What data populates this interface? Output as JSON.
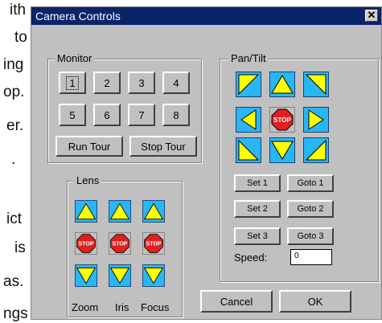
{
  "background_fragments": [
    "ith",
    "to",
    "ing",
    "op.",
    "er.",
    ".",
    "ict",
    "is",
    "as.",
    "ngs"
  ],
  "dialog": {
    "title": "Camera Controls",
    "close_symbol": "✕"
  },
  "monitor": {
    "label": "Monitor",
    "buttons": [
      "1",
      "2",
      "3",
      "4",
      "5",
      "6",
      "7",
      "8"
    ],
    "run_tour": "Run Tour",
    "stop_tour": "Stop Tour"
  },
  "pantilt": {
    "label": "Pan/Tilt",
    "stop_text": "STOP",
    "presets": [
      {
        "set": "Set 1",
        "goto": "Goto 1"
      },
      {
        "set": "Set 2",
        "goto": "Goto 2"
      },
      {
        "set": "Set 3",
        "goto": "Goto 3"
      }
    ],
    "speed_label": "Speed:",
    "speed_value": "0"
  },
  "lens": {
    "label": "Lens",
    "stop_text": "STOP",
    "columns": [
      "Zoom",
      "Iris",
      "Focus"
    ]
  },
  "actions": {
    "cancel": "Cancel",
    "ok": "OK"
  },
  "colors": {
    "titlebar": "#0a246a",
    "dialog_bg": "#c0c0c0",
    "arrow_fill": "#ffff00",
    "arrow_bg": "#29b6f6",
    "stop_red": "#e02020"
  }
}
